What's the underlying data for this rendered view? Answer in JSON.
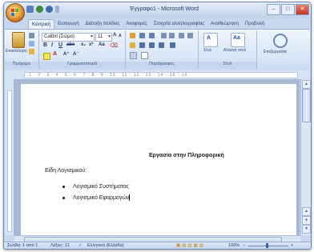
{
  "window": {
    "title": "Έγγραφο1 - Microsoft Word",
    "controls": {
      "minimize": "–",
      "maximize": "□",
      "close": "✕"
    }
  },
  "tabs": [
    {
      "label": "Κεντρική",
      "active": true
    },
    {
      "label": "Εισαγωγή",
      "active": false
    },
    {
      "label": "Διάταξη σελίδας",
      "active": false
    },
    {
      "label": "Αναφορές",
      "active": false
    },
    {
      "label": "Στοιχεία αλληλογραφίας",
      "active": false
    },
    {
      "label": "Αναθεώρηση",
      "active": false
    },
    {
      "label": "Προβολή",
      "active": false
    }
  ],
  "ribbon": {
    "clipboard": {
      "paste_label": "Επικόλληση",
      "group_label": "Πρόχειρο"
    },
    "font": {
      "font_name": "Calibri (Σώμα)",
      "font_size": "11",
      "group_label": "Γραμματοσειρά"
    },
    "paragraph": {
      "group_label": "Παράγραφος"
    },
    "styles": {
      "quick_styles_label": "Στυλ",
      "change_styles_label": "Αλλαγή στυλ",
      "group_label": "Στυλ"
    },
    "editing": {
      "label": "Επεξεργασία"
    }
  },
  "document": {
    "title": "Εργασία στην Πληροφορική",
    "line1": "Είδη Λογισμικού:",
    "bullets": [
      "Λογισμικό Συστήματος",
      "Λογισμικό Εφαρμογών"
    ]
  },
  "statusbar": {
    "page": "Σελίδα: 1 από 1",
    "words": "Λέξεις: 11",
    "language": "Ελληνικά (Ελλάδα)",
    "zoom": "100%"
  },
  "colors": {
    "accent": "#c7d7ee",
    "tab_active": "#eaf1fb",
    "ribbon": "#d9e6f6"
  }
}
